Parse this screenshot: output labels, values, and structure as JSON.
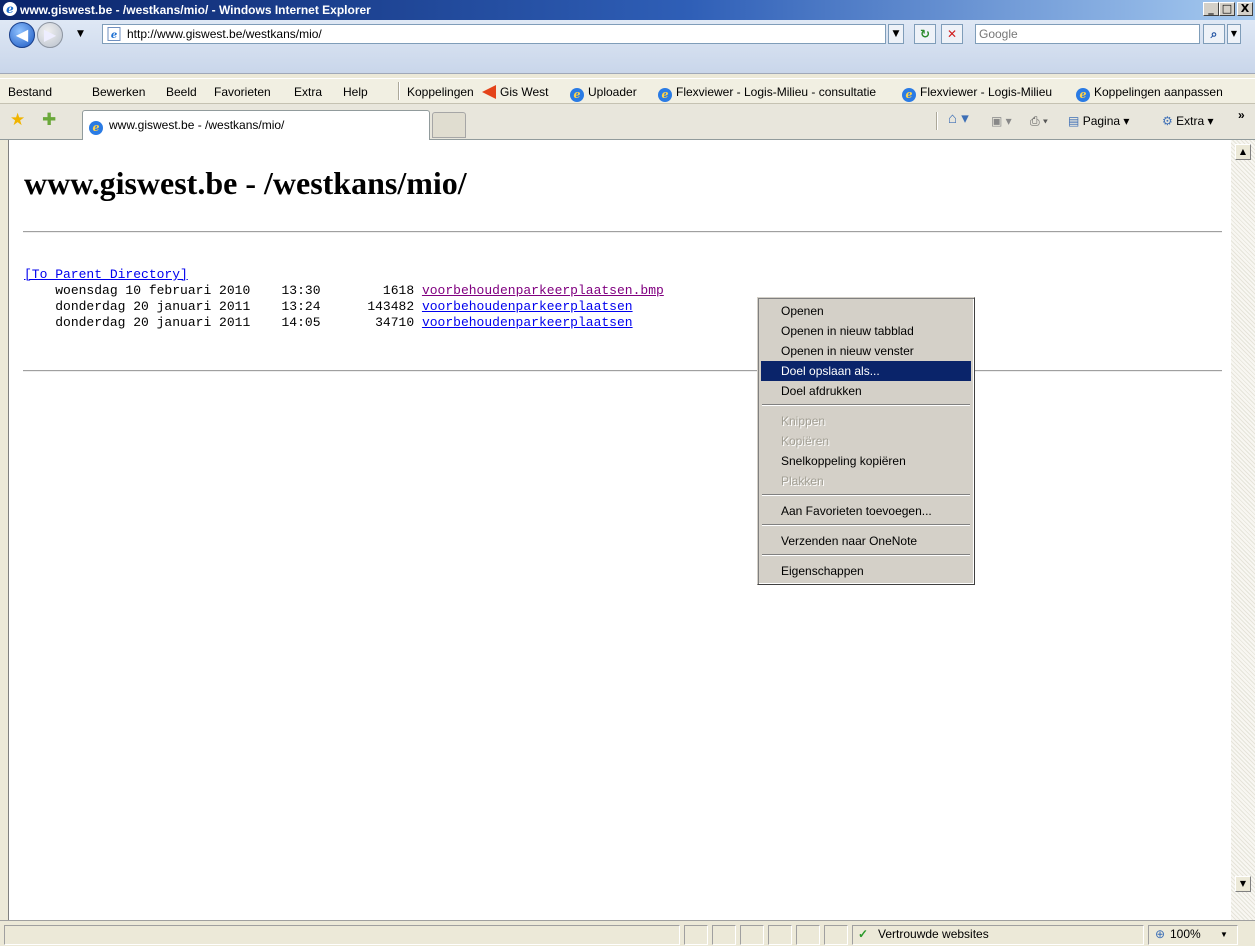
{
  "window": {
    "title": "www.giswest.be - /westkans/mio/ - Windows Internet Explorer",
    "min_label": "_",
    "max_label": "□",
    "close_label": "X"
  },
  "address": {
    "url": "http://www.giswest.be/westkans/mio/",
    "search_placeholder": "Google"
  },
  "menubar": {
    "items": [
      "Bestand",
      "Bewerken",
      "Beeld",
      "Favorieten",
      "Extra",
      "Help"
    ],
    "links_label": "Koppelingen",
    "links": [
      "Gis West",
      "Uploader",
      "Flexviewer - Logis-Milieu - consultatie",
      "Flexviewer - Logis-Milieu",
      "Koppelingen aanpassen"
    ]
  },
  "tabs": {
    "active_title": "www.giswest.be - /westkans/mio/"
  },
  "toolbar": {
    "page_label": "Pagina",
    "extra_label": "Extra",
    "chevron": "»"
  },
  "page": {
    "heading": "www.giswest.be - /westkans/mio/",
    "parent_link": "[To Parent Directory]",
    "rows": [
      {
        "date": "woensdag 10 februari 2010",
        "time": "13:30",
        "size": "1618",
        "name": "voorbehoudenparkeerplaatsen.bmp"
      },
      {
        "date": "donderdag 20 januari 2011",
        "time": "13:24",
        "size": "143482",
        "name": "voorbehoudenparkeerplaatsen"
      },
      {
        "date": "donderdag 20 januari 2011",
        "time": "14:05",
        "size": "34710",
        "name": "voorbehoudenparkeerplaatsen"
      }
    ]
  },
  "context_menu": {
    "items": [
      {
        "label": "Openen"
      },
      {
        "label": "Openen in nieuw tabblad"
      },
      {
        "label": "Openen in nieuw venster"
      },
      {
        "label": "Doel opslaan als..."
      },
      {
        "label": "Doel afdrukken"
      },
      {
        "label": "Knippen"
      },
      {
        "label": "Kopiëren"
      },
      {
        "label": "Snelkoppeling kopiëren"
      },
      {
        "label": "Plakken"
      },
      {
        "label": "Aan Favorieten toevoegen..."
      },
      {
        "label": "Verzenden naar OneNote"
      },
      {
        "label": "Eigenschappen"
      }
    ],
    "highlighted": "Doel opslaan als...",
    "disabled": [
      "Knippen",
      "Kopiëren",
      "Plakken"
    ]
  },
  "statusbar": {
    "zone": "Vertrouwde websites",
    "zoom": "100%"
  },
  "colors": {
    "link": "#0000ee",
    "visited": "#800080",
    "menu_highlight": "#0a246a",
    "title_bar": "#0a246a"
  }
}
